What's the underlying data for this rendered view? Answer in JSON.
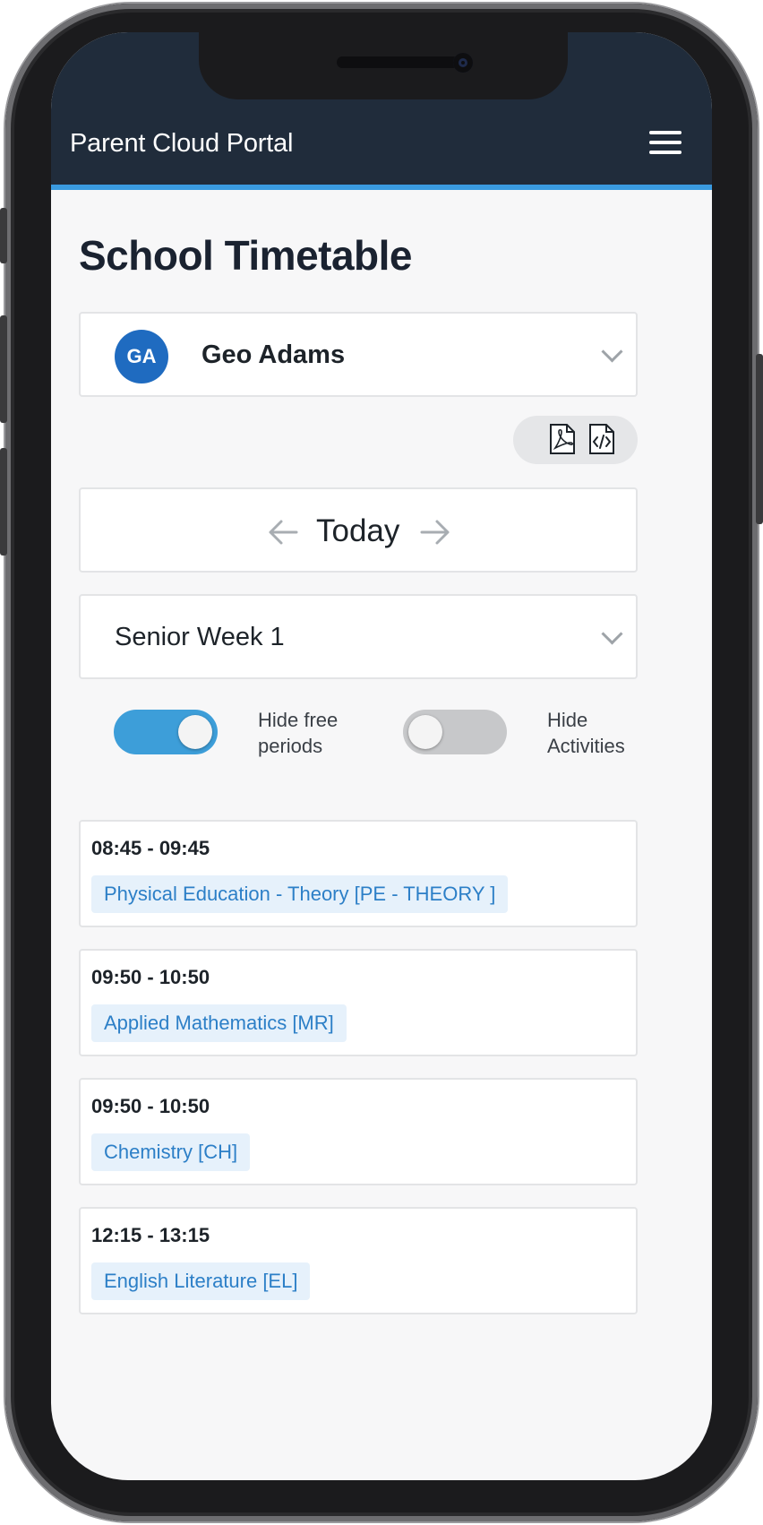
{
  "app": {
    "title": "Parent Cloud Portal"
  },
  "page": {
    "title": "School Timetable"
  },
  "student": {
    "initials": "GA",
    "name": "Geo Adams"
  },
  "export": {
    "pdf_icon": "pdf-file-icon",
    "code_icon": "code-file-icon"
  },
  "date_nav": {
    "label": "Today"
  },
  "week": {
    "label": "Senior Week 1"
  },
  "toggles": {
    "free_periods": {
      "label_line1": "Hide free",
      "label_line2": "periods",
      "on": true
    },
    "activities": {
      "label_line1": "Hide",
      "label_line2": "Activities",
      "on": false
    }
  },
  "colors": {
    "header": "#202c3b",
    "accent": "#3a9be0",
    "avatar": "#1f6bc0",
    "chip_bg": "#e6f1fb",
    "chip_text": "#2c7fc7"
  },
  "periods": [
    {
      "time": "08:45 - 09:45",
      "subject": "Physical Education - Theory [PE - THEORY ]"
    },
    {
      "time": "09:50 - 10:50",
      "subject": "Applied Mathematics [MR]"
    },
    {
      "time": "09:50 - 10:50",
      "subject": "Chemistry [CH]"
    },
    {
      "time": "12:15 - 13:15",
      "subject": "English Literature [EL]"
    }
  ]
}
